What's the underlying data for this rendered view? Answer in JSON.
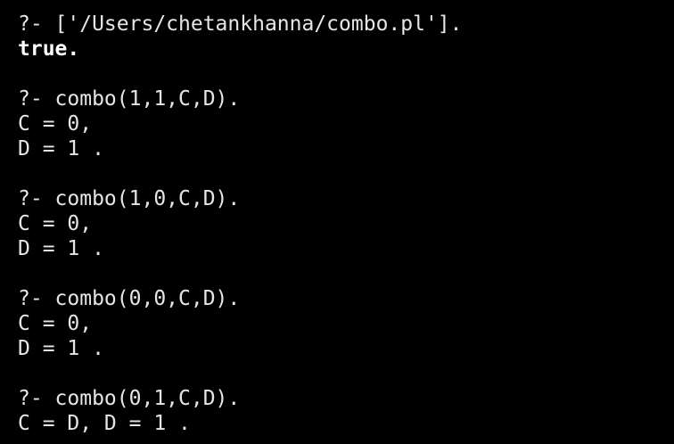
{
  "terminal": {
    "colors": {
      "background": "#000000",
      "foreground": "#e6e6e6"
    },
    "lines": [
      "?- ['/Users/chetankhanna/combo.pl'].",
      "true.",
      "",
      "?- combo(1,1,C,D).",
      "C = 0,",
      "D = 1 .",
      "",
      "?- combo(1,0,C,D).",
      "C = 0,",
      "D = 1 .",
      "",
      "?- combo(0,0,C,D).",
      "C = 0,",
      "D = 1 .",
      "",
      "?- combo(0,1,C,D).",
      "C = D, D = 1 ."
    ]
  }
}
